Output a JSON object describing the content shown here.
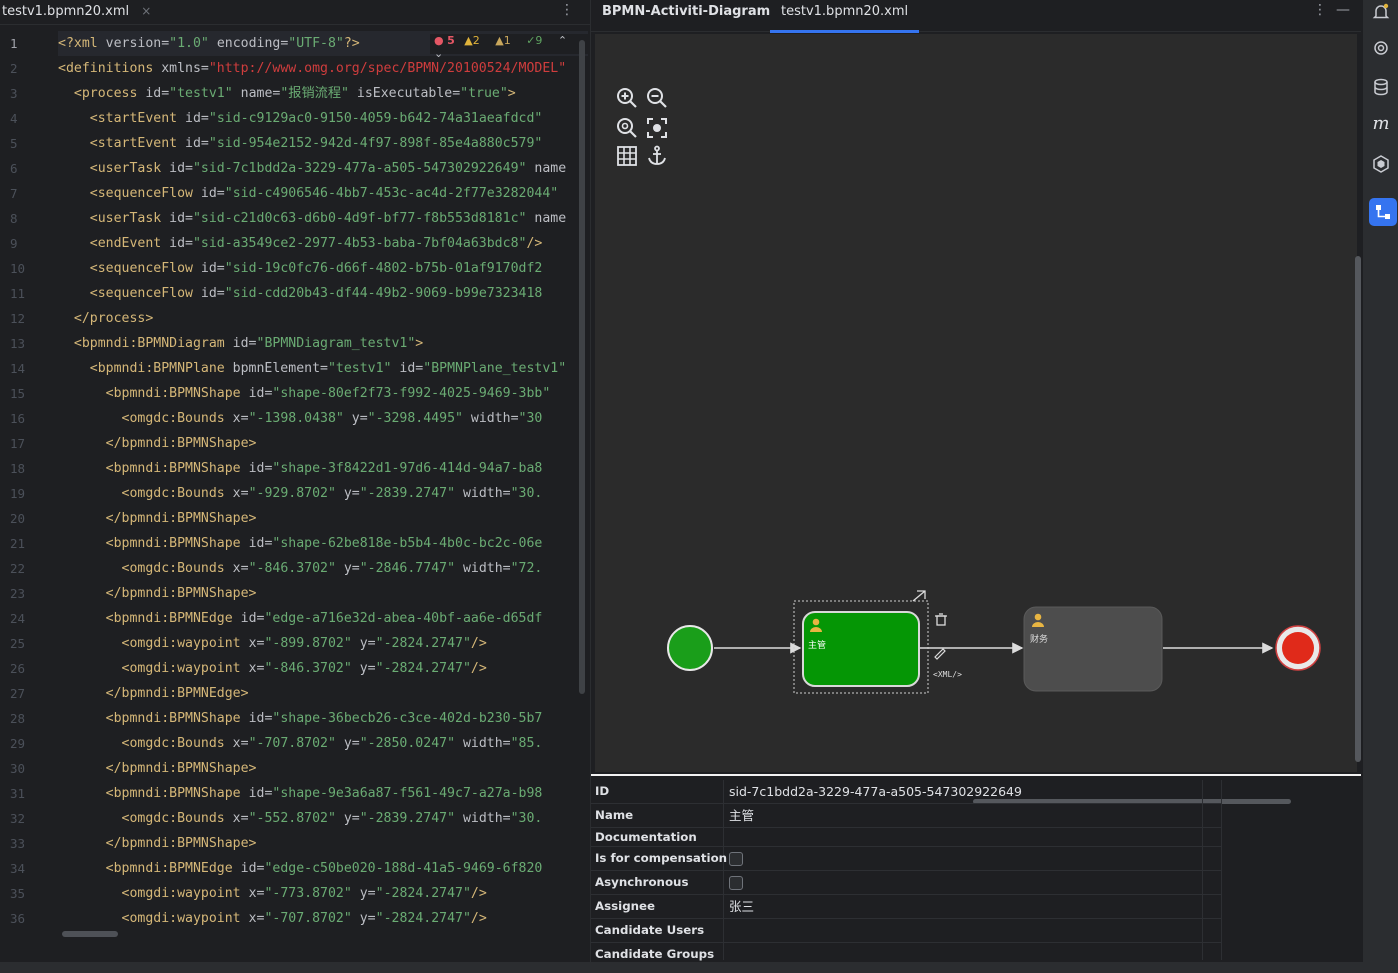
{
  "editor": {
    "tab_label": "testv1.bpmn20.xml",
    "tab_close": "×",
    "more_icon": "more-vertical-icon",
    "inspections": {
      "errors": "5",
      "warnings": "2",
      "weak_warnings": "1",
      "ok": "9"
    },
    "line_numbers": [
      "1",
      "2",
      "3",
      "4",
      "5",
      "6",
      "7",
      "8",
      "9",
      "10",
      "11",
      "12",
      "13",
      "14",
      "15",
      "16",
      "17",
      "18",
      "19",
      "20",
      "21",
      "22",
      "23",
      "24",
      "25",
      "26",
      "27",
      "28",
      "29",
      "30",
      "31",
      "32",
      "33",
      "34",
      "35",
      "36"
    ],
    "lines": [
      [
        [
          "tag",
          "<?xml "
        ],
        [
          "attr",
          "version="
        ],
        [
          "val",
          "\"1.0\""
        ],
        [
          "attr",
          " encoding="
        ],
        [
          "val",
          "\"UTF-8\""
        ],
        [
          "tag",
          "?>"
        ]
      ],
      [
        [
          "tag",
          "<definitions "
        ],
        [
          "attr",
          "xmlns="
        ],
        [
          "url",
          "\"http://www.omg.org/spec/BPMN/20100524/MODEL\""
        ]
      ],
      [
        [
          "tag",
          "  <process "
        ],
        [
          "attr",
          "id="
        ],
        [
          "val",
          "\"testv1\""
        ],
        [
          "attr",
          " name="
        ],
        [
          "val",
          "\"报销流程\""
        ],
        [
          "attr",
          " isExecutable="
        ],
        [
          "val",
          "\"true\""
        ],
        [
          "tag",
          ">"
        ]
      ],
      [
        [
          "tag",
          "    <startEvent "
        ],
        [
          "attr",
          "id="
        ],
        [
          "val",
          "\"sid-c9129ac0-9150-4059-b642-74a31aeafdcd\""
        ]
      ],
      [
        [
          "tag",
          "    <startEvent "
        ],
        [
          "attr",
          "id="
        ],
        [
          "val",
          "\"sid-954e2152-942d-4f97-898f-85e4a880c579\""
        ]
      ],
      [
        [
          "tag",
          "    <userTask "
        ],
        [
          "attr",
          "id="
        ],
        [
          "val",
          "\"sid-7c1bdd2a-3229-477a-a505-547302922649\""
        ],
        [
          "attr",
          " name"
        ]
      ],
      [
        [
          "tag",
          "    <sequenceFlow "
        ],
        [
          "attr",
          "id="
        ],
        [
          "val",
          "\"sid-c4906546-4bb7-453c-ac4d-2f77e3282044\""
        ]
      ],
      [
        [
          "tag",
          "    <userTask "
        ],
        [
          "attr",
          "id="
        ],
        [
          "val",
          "\"sid-c21d0c63-d6b0-4d9f-bf77-f8b553d8181c\""
        ],
        [
          "attr",
          " name"
        ]
      ],
      [
        [
          "tag",
          "    <endEvent "
        ],
        [
          "attr",
          "id="
        ],
        [
          "val",
          "\"sid-a3549ce2-2977-4b53-baba-7bf04a63bdc8\""
        ],
        [
          "tag",
          "/>"
        ]
      ],
      [
        [
          "tag",
          "    <sequenceFlow "
        ],
        [
          "attr",
          "id="
        ],
        [
          "val",
          "\"sid-19c0fc76-d66f-4802-b75b-01af9170df2"
        ]
      ],
      [
        [
          "tag",
          "    <sequenceFlow "
        ],
        [
          "attr",
          "id="
        ],
        [
          "val",
          "\"sid-cdd20b43-df44-49b2-9069-b99e7323418"
        ]
      ],
      [
        [
          "tag",
          "  </process>"
        ]
      ],
      [
        [
          "tag",
          "  <bpmndi:BPMNDiagram "
        ],
        [
          "attr",
          "id="
        ],
        [
          "val",
          "\"BPMNDiagram_testv1\""
        ],
        [
          "tag",
          ">"
        ]
      ],
      [
        [
          "tag",
          "    <bpmndi:BPMNPlane "
        ],
        [
          "attr",
          "bpmnElement="
        ],
        [
          "val",
          "\"testv1\""
        ],
        [
          "attr",
          " id="
        ],
        [
          "val",
          "\"BPMNPlane_testv1\""
        ]
      ],
      [
        [
          "tag",
          "      <bpmndi:BPMNShape "
        ],
        [
          "attr",
          "id="
        ],
        [
          "val",
          "\"shape-80ef2f73-f992-4025-9469-3bb\""
        ]
      ],
      [
        [
          "tag",
          "        <omgdc:Bounds "
        ],
        [
          "attr",
          "x="
        ],
        [
          "val",
          "\"-1398.0438\""
        ],
        [
          "attr",
          " y="
        ],
        [
          "val",
          "\"-3298.4495\""
        ],
        [
          "attr",
          " width="
        ],
        [
          "val",
          "\"30"
        ]
      ],
      [
        [
          "tag",
          "      </bpmndi:BPMNShape>"
        ]
      ],
      [
        [
          "tag",
          "      <bpmndi:BPMNShape "
        ],
        [
          "attr",
          "id="
        ],
        [
          "val",
          "\"shape-3f8422d1-97d6-414d-94a7-ba8"
        ]
      ],
      [
        [
          "tag",
          "        <omgdc:Bounds "
        ],
        [
          "attr",
          "x="
        ],
        [
          "val",
          "\"-929.8702\""
        ],
        [
          "attr",
          " y="
        ],
        [
          "val",
          "\"-2839.2747\""
        ],
        [
          "attr",
          " width="
        ],
        [
          "val",
          "\"30."
        ]
      ],
      [
        [
          "tag",
          "      </bpmndi:BPMNShape>"
        ]
      ],
      [
        [
          "tag",
          "      <bpmndi:BPMNShape "
        ],
        [
          "attr",
          "id="
        ],
        [
          "val",
          "\"shape-62be818e-b5b4-4b0c-bc2c-06e"
        ]
      ],
      [
        [
          "tag",
          "        <omgdc:Bounds "
        ],
        [
          "attr",
          "x="
        ],
        [
          "val",
          "\"-846.3702\""
        ],
        [
          "attr",
          " y="
        ],
        [
          "val",
          "\"-2846.7747\""
        ],
        [
          "attr",
          " width="
        ],
        [
          "val",
          "\"72."
        ]
      ],
      [
        [
          "tag",
          "      </bpmndi:BPMNShape>"
        ]
      ],
      [
        [
          "tag",
          "      <bpmndi:BPMNEdge "
        ],
        [
          "attr",
          "id="
        ],
        [
          "val",
          "\"edge-a716e32d-abea-40bf-aa6e-d65df"
        ]
      ],
      [
        [
          "tag",
          "        <omgdi:waypoint "
        ],
        [
          "attr",
          "x="
        ],
        [
          "val",
          "\"-899.8702\""
        ],
        [
          "attr",
          " y="
        ],
        [
          "val",
          "\"-2824.2747\""
        ],
        [
          "tag",
          "/>"
        ]
      ],
      [
        [
          "tag",
          "        <omgdi:waypoint "
        ],
        [
          "attr",
          "x="
        ],
        [
          "val",
          "\"-846.3702\""
        ],
        [
          "attr",
          " y="
        ],
        [
          "val",
          "\"-2824.2747\""
        ],
        [
          "tag",
          "/>"
        ]
      ],
      [
        [
          "tag",
          "      </bpmndi:BPMNEdge>"
        ]
      ],
      [
        [
          "tag",
          "      <bpmndi:BPMNShape "
        ],
        [
          "attr",
          "id="
        ],
        [
          "val",
          "\"shape-36becb26-c3ce-402d-b230-5b7"
        ]
      ],
      [
        [
          "tag",
          "        <omgdc:Bounds "
        ],
        [
          "attr",
          "x="
        ],
        [
          "val",
          "\"-707.8702\""
        ],
        [
          "attr",
          " y="
        ],
        [
          "val",
          "\"-2850.0247\""
        ],
        [
          "attr",
          " width="
        ],
        [
          "val",
          "\"85."
        ]
      ],
      [
        [
          "tag",
          "      </bpmndi:BPMNShape>"
        ]
      ],
      [
        [
          "tag",
          "      <bpmndi:BPMNShape "
        ],
        [
          "attr",
          "id="
        ],
        [
          "val",
          "\"shape-9e3a6a87-f561-49c7-a27a-b98"
        ]
      ],
      [
        [
          "tag",
          "        <omgdc:Bounds "
        ],
        [
          "attr",
          "x="
        ],
        [
          "val",
          "\"-552.8702\""
        ],
        [
          "attr",
          " y="
        ],
        [
          "val",
          "\"-2839.2747\""
        ],
        [
          "attr",
          " width="
        ],
        [
          "val",
          "\"30."
        ]
      ],
      [
        [
          "tag",
          "      </bpmndi:BPMNShape>"
        ]
      ],
      [
        [
          "tag",
          "      <bpmndi:BPMNEdge "
        ],
        [
          "attr",
          "id="
        ],
        [
          "val",
          "\"edge-c50be020-188d-41a5-9469-6f820"
        ]
      ],
      [
        [
          "tag",
          "        <omgdi:waypoint "
        ],
        [
          "attr",
          "x="
        ],
        [
          "val",
          "\"-773.8702\""
        ],
        [
          "attr",
          " y="
        ],
        [
          "val",
          "\"-2824.2747\""
        ],
        [
          "tag",
          "/>"
        ]
      ],
      [
        [
          "tag",
          "        <omgdi:waypoint "
        ],
        [
          "attr",
          "x="
        ],
        [
          "val",
          "\"-707.8702\""
        ],
        [
          "attr",
          " y="
        ],
        [
          "val",
          "\"-2824.2747\""
        ],
        [
          "tag",
          "/>"
        ]
      ]
    ]
  },
  "diagram": {
    "tab_diagram": "BPMN-Activiti-Diagram",
    "tab_xml": "testv1.bpmn20.xml",
    "more_icon": "more-vertical-icon",
    "minimize_icon": "minimize-icon",
    "toolbar": [
      "zoom-in-icon",
      "zoom-out-icon",
      "zoom-reset-icon",
      "fit-to-screen-icon",
      "grid-icon",
      "anchor-icon"
    ],
    "task1_label": "主管",
    "task2_label": "财务",
    "xml_label": "<XML/>",
    "colors": {
      "start": "#1a9e1a",
      "task_selected": "#059605",
      "task": "#4d4d4d",
      "end": "#e02a1a",
      "accent": "#3574f0"
    }
  },
  "properties": {
    "id_label": "ID",
    "id_value": "sid-7c1bdd2a-3229-477a-a505-547302922649",
    "name_label": "Name",
    "name_value": "主管",
    "documentation_label": "Documentation",
    "compensation_label": "Is for compensation",
    "async_label": "Asynchronous",
    "assignee_label": "Assignee",
    "assignee_value": "张三",
    "candidate_users_label": "Candidate Users",
    "candidate_groups_label": "Candidate Groups"
  },
  "right_strip": [
    "notifications-icon",
    "ai-assistant-icon",
    "database-icon",
    "m-icon",
    "plugin-icon",
    "bpmn-tool-icon"
  ]
}
